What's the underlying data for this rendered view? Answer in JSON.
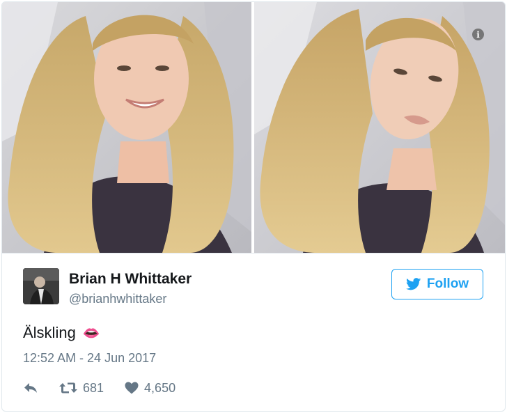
{
  "tweet": {
    "author_name": "Brian H Whittaker",
    "author_handle": "@brianhwhittaker",
    "follow_label": "Follow",
    "text": "Älskling",
    "emoji": "👄",
    "timestamp": "12:52 AM - 24 Jun 2017",
    "retweet_count": "681",
    "like_count": "4,650"
  },
  "media": {
    "info_label": "i"
  },
  "colors": {
    "brand_blue": "#1da1f2",
    "secondary_text": "#657786",
    "primary_text": "#14171a",
    "border": "#e1e8ed"
  },
  "icons": {
    "reply": "reply-icon",
    "retweet": "retweet-icon",
    "like": "heart-icon",
    "brand": "twitter-bird-icon",
    "info": "info-icon"
  }
}
